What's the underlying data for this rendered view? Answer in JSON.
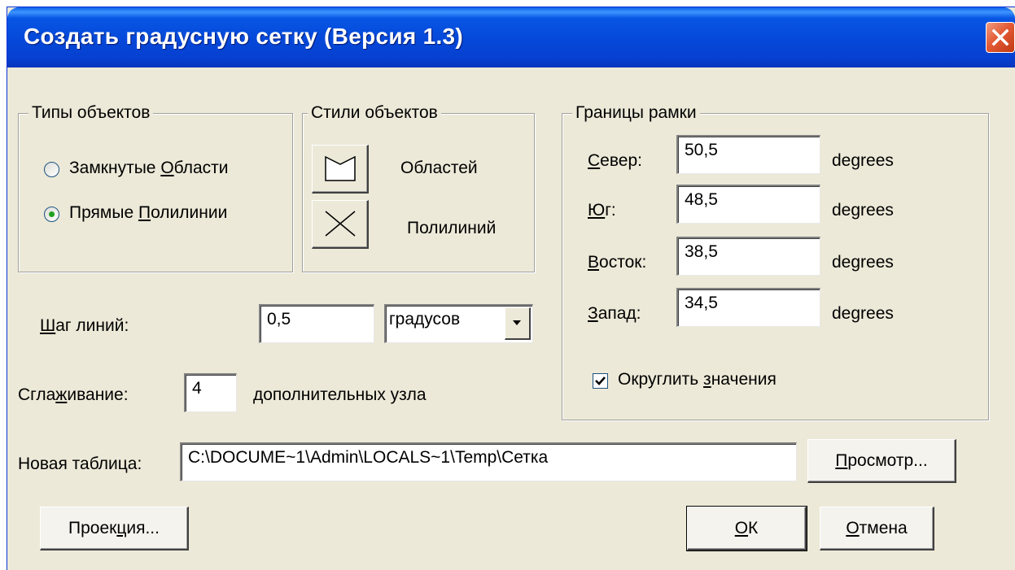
{
  "window": {
    "title": "Создать градусную сетку (Версия 1.3)"
  },
  "object_types": {
    "legend": "Типы объектов",
    "options": [
      {
        "pre": "Замкнутые ",
        "key": "О",
        "post": "бласти",
        "selected": false
      },
      {
        "pre": "Прямые ",
        "key": "П",
        "post": "олилинии",
        "selected": true
      }
    ]
  },
  "object_styles": {
    "legend": "Стили объектов",
    "regions_label": "Областей",
    "polylines_label": "Полилиний"
  },
  "bounds": {
    "legend": "Границы рамки",
    "rows": [
      {
        "key": "С",
        "post": "евер:",
        "value": "50,5",
        "unit": "degrees"
      },
      {
        "key": "Ю",
        "post": "г:",
        "value": "48,5",
        "unit": "degrees"
      },
      {
        "key": "В",
        "post": "осток:",
        "value": "38,5",
        "unit": "degrees"
      },
      {
        "key": "З",
        "post": "апад:",
        "value": "34,5",
        "unit": "degrees"
      }
    ],
    "round": {
      "pre": "Округлить ",
      "key": "з",
      "post": "начения",
      "checked": true
    }
  },
  "step": {
    "key": "Ш",
    "post": "аг линий:",
    "value": "0,5",
    "unit_selected": "градусов"
  },
  "smoothing": {
    "pre": "Сгла",
    "key": "ж",
    "post": "ивание:",
    "value": "4",
    "suffix": "дополнительных узла"
  },
  "new_table": {
    "label": "Новая таблица:",
    "value": "C:\\DOCUME~1\\Admin\\LOCALS~1\\Temp\\Сетка"
  },
  "buttons": {
    "browse": {
      "key": "П",
      "post": "росмотр..."
    },
    "projection": {
      "pre": "Проек",
      "key": "ц",
      "post": "ия..."
    },
    "ok": {
      "key": "О",
      "post": "К"
    },
    "cancel": {
      "key": "О",
      "post": "тмена"
    }
  },
  "colors": {
    "titlebar": "#0548d9",
    "dialog_bg": "#ece9d8",
    "close_button": "#e35a34",
    "radio_dot": "#21a121"
  },
  "icons": [
    "close-icon",
    "region-style-icon",
    "polyline-style-icon",
    "dropdown-arrow-icon",
    "checkmark-icon"
  ]
}
